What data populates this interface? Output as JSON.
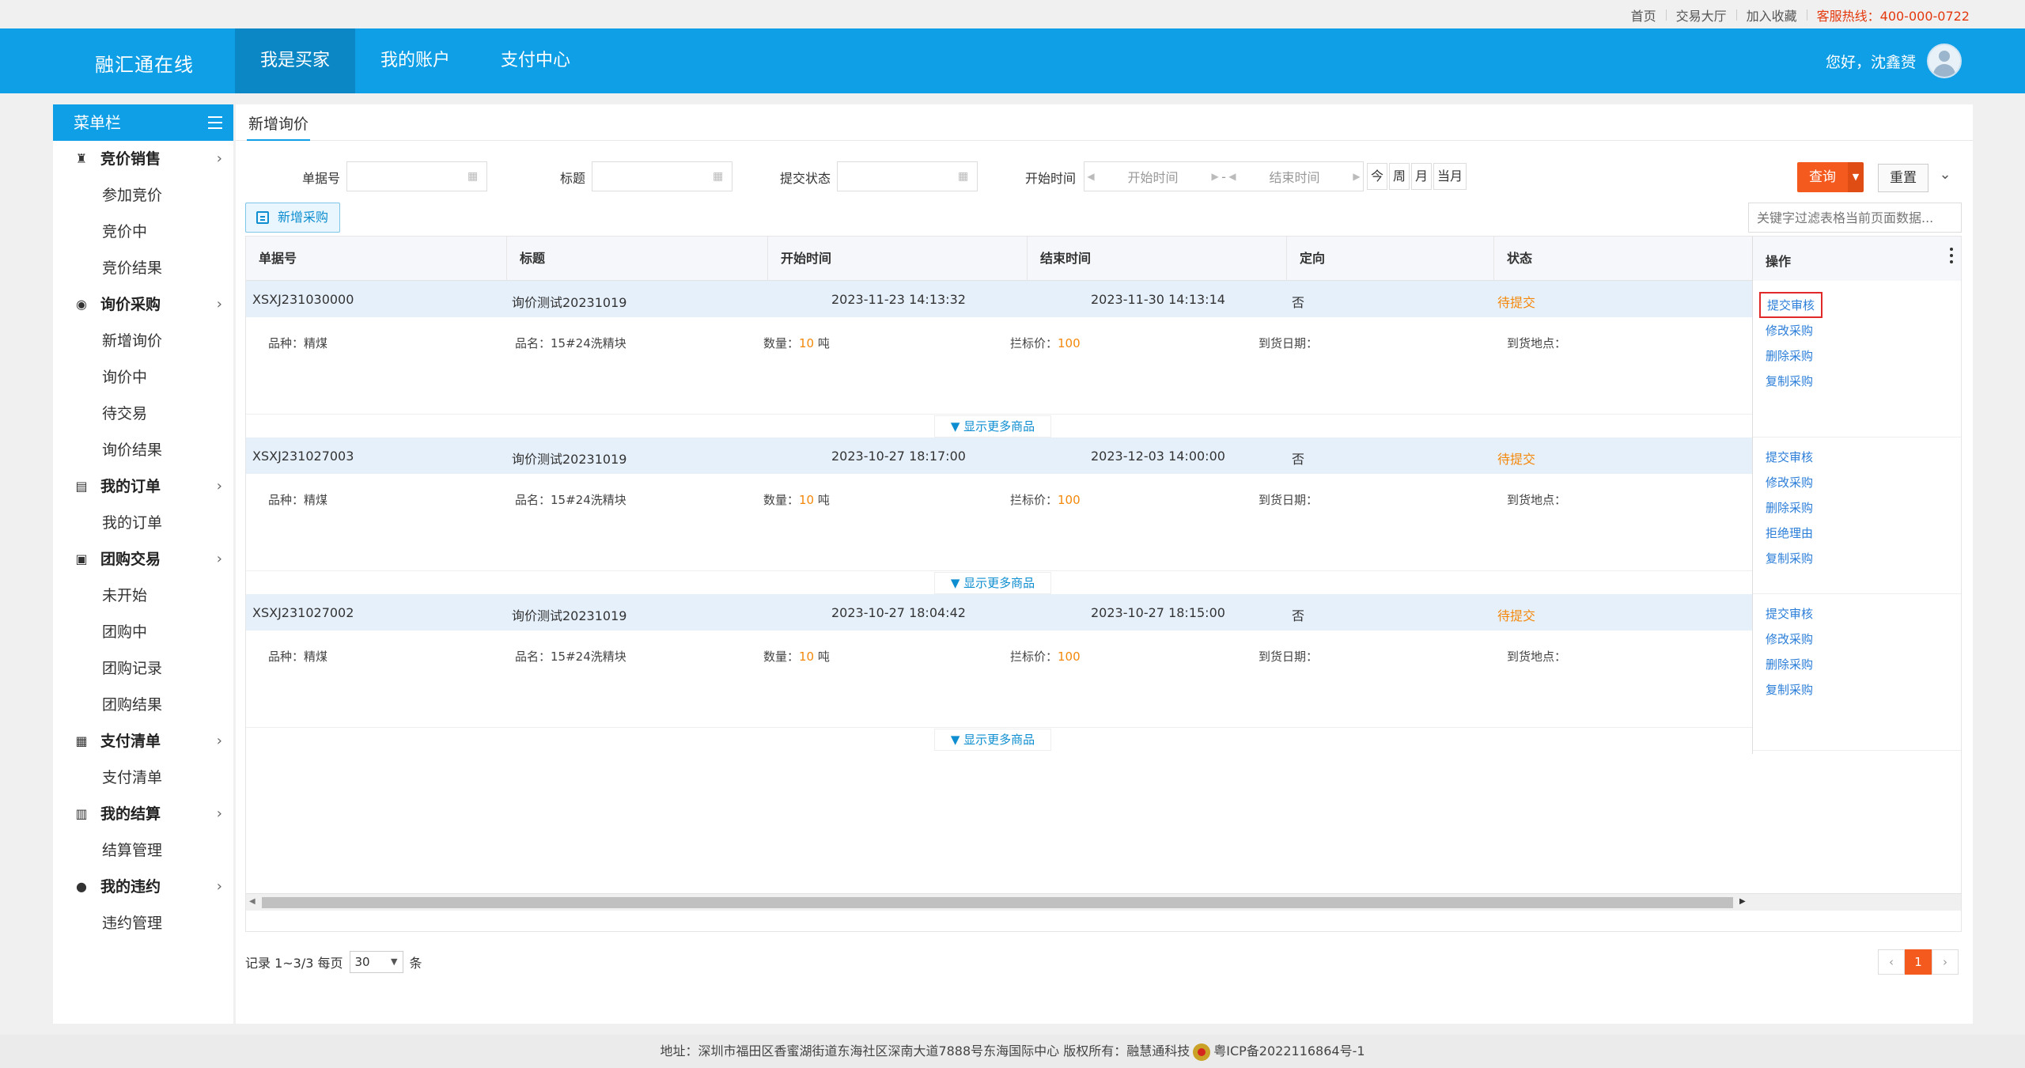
{
  "topbar": {
    "links": [
      "首页",
      "交易大厅",
      "加入收藏"
    ],
    "hotline": "客服热线：400-000-0722"
  },
  "header": {
    "brand": "融汇通在线",
    "nav": [
      "我是买家",
      "我的账户",
      "支付中心"
    ],
    "greeting": "您好，沈鑫赟"
  },
  "sidebar": {
    "title": "菜单栏",
    "groups": [
      {
        "title": "竞价销售",
        "icon": "gavel-icon",
        "items": [
          "参加竞价",
          "竞价中",
          "竞价结果"
        ]
      },
      {
        "title": "询价采购",
        "icon": "inquiry-icon",
        "items": [
          "新增询价",
          "询价中",
          "待交易",
          "询价结果"
        ]
      },
      {
        "title": "我的订单",
        "icon": "document-icon",
        "items": [
          "我的订单"
        ]
      },
      {
        "title": "团购交易",
        "icon": "group-buy-icon",
        "items": [
          "未开始",
          "团购中",
          "团购记录",
          "团购结果"
        ]
      },
      {
        "title": "支付清单",
        "icon": "wallet-icon",
        "items": [
          "支付清单"
        ]
      },
      {
        "title": "我的结算",
        "icon": "calculator-icon",
        "items": [
          "结算管理"
        ]
      },
      {
        "title": "我的违约",
        "icon": "warning-icon",
        "items": [
          "违约管理"
        ]
      }
    ]
  },
  "main": {
    "tab": "新增询价",
    "filters": {
      "order_no_label": "单据号",
      "title_label": "标题",
      "status_label": "提交状态",
      "start_time_label": "开始时间",
      "start_placeholder": "开始时间",
      "end_placeholder": "结束时间",
      "range_sep": "-",
      "quick": [
        "今",
        "周",
        "月",
        "当月"
      ],
      "query": "查询",
      "reset": "重置"
    },
    "add_button": "新增采购",
    "search_placeholder": "关键字过滤表格当前页面数据...",
    "columns": [
      "单据号",
      "标题",
      "开始时间",
      "结束时间",
      "定向",
      "状态",
      "操作"
    ],
    "detail_labels": {
      "variety": "品种：",
      "name": "品名：",
      "qty": "数量：",
      "price": "拦标价：",
      "arrival_date": "到货日期：",
      "arrival_place": "到货地点："
    },
    "show_more": "显示更多商品",
    "rows": [
      {
        "no": "XSXJ231030000",
        "title": "询价测试20231019",
        "start": "2023-11-23 14:13:32",
        "end": "2023-11-30 14:13:14",
        "direct": "否",
        "status": "待提交",
        "variety": "精煤",
        "name": "15#24洗精块",
        "qty": "10",
        "unit": "吨",
        "price": "100",
        "ops": [
          "提交审核",
          "修改采购",
          "删除采购",
          "复制采购"
        ]
      },
      {
        "no": "XSXJ231027003",
        "title": "询价测试20231019",
        "start": "2023-10-27 18:17:00",
        "end": "2023-12-03 14:00:00",
        "direct": "否",
        "status": "待提交",
        "variety": "精煤",
        "name": "15#24洗精块",
        "qty": "10",
        "unit": "吨",
        "price": "100",
        "ops": [
          "提交审核",
          "修改采购",
          "删除采购",
          "拒绝理由",
          "复制采购"
        ]
      },
      {
        "no": "XSXJ231027002",
        "title": "询价测试20231019",
        "start": "2023-10-27 18:04:42",
        "end": "2023-10-27 18:15:00",
        "direct": "否",
        "status": "待提交",
        "variety": "精煤",
        "name": "15#24洗精块",
        "qty": "10",
        "unit": "吨",
        "price": "100",
        "ops": [
          "提交审核",
          "修改采购",
          "删除采购",
          "复制采购"
        ]
      }
    ],
    "pager": {
      "record_text": "记录 1~3/3 每页",
      "page_size": "30",
      "unit": "条",
      "current_page": "1",
      "prev": "‹",
      "next": "›"
    }
  },
  "footer": {
    "text": "地址：深圳市福田区香蜜湖街道东海社区深南大道7888号东海国际中心   版权所有：融慧通科技",
    "icp": "粤ICP备2022116864号-1"
  },
  "colors": {
    "primary": "#0e9fe6",
    "accent": "#f45a1e",
    "status": "#f4880b",
    "link": "#2a7dd8"
  }
}
